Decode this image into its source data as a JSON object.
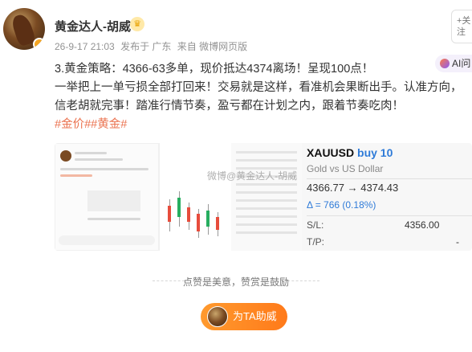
{
  "author": {
    "name": "黄金达人-胡威",
    "badge_icon": "crown-icon"
  },
  "meta": {
    "time": "26-9-17 21:03",
    "location": "发布于 广东",
    "source": "来自 微博网页版"
  },
  "follow_button": {
    "label": "+关\n注"
  },
  "ai_button": {
    "label": "AI问"
  },
  "post": {
    "line1": "3.黄金策略：4366-63多单，现价抵达4374离场！呈现100点！",
    "line2": "一举把上一单亏损全部打回来！交易就是这样，看准机会果断出手。认准方向，",
    "line3": "信老胡就完事！踏准行情节奏，盈亏都在计划之内，跟着节奏吃肉！",
    "tags": "#金价##黄金#"
  },
  "trade_card": {
    "symbol": "XAUUSD",
    "side": "buy 10",
    "description": "Gold vs US Dollar",
    "prices": "4366.77 → 4374.43",
    "delta": "Δ = 766 (0.18%)",
    "sl_label": "S/L:",
    "sl_value": "4356.00",
    "tp_label": "T/P:",
    "tp_value": "-"
  },
  "watermark": "微博@黄金达人-胡威",
  "footer": {
    "divider_text": "点赞是美意，赞赏是鼓励",
    "reward_label": "为TA助威"
  },
  "colors": {
    "tag": "#eb7350",
    "accent_blue": "#2f7bd8",
    "reward_orange": "#ff8a24"
  }
}
